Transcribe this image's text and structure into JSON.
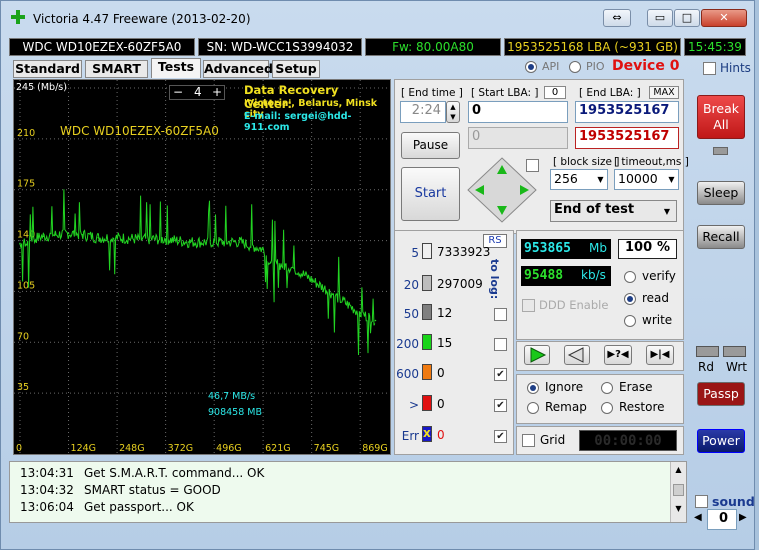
{
  "window": {
    "title": "Victoria 4.47  Freeware (2013-02-20)",
    "time": "15:45:39",
    "controls": {
      "restore": "⇔",
      "minimize": "▭",
      "maximize": "□",
      "close": "✕"
    }
  },
  "infobar": {
    "model": "WDC WD10EZEX-60ZF5A0",
    "serial": "SN: WD-WCC1S3994032",
    "firmware": "Fw: 80.00A80",
    "lba": "1953525168 LBA (~931 GB)"
  },
  "tabs": [
    {
      "label": "Standard"
    },
    {
      "label": "SMART"
    },
    {
      "label": "Tests",
      "active": true
    },
    {
      "label": "Advanced"
    },
    {
      "label": "Setup"
    }
  ],
  "mode": {
    "api": "API",
    "pio": "PIO",
    "device": "Device 0",
    "hints": "Hints"
  },
  "graph": {
    "unit": "245 (Mb/s)",
    "drive_label": "WDC WD10EZEX-60ZF5A0",
    "spinner_value": "4",
    "minus": "−",
    "plus": "+",
    "recovery_title": "Data Recovery Center:",
    "recovery_line1": "'Victoria', Belarus, Minsk city",
    "recovery_line2": "E-mail: sergei@hdd-911.com",
    "y_ticks": [
      "210",
      "175",
      "140",
      "105",
      "70",
      "35"
    ],
    "x_ticks": [
      "0",
      "124G",
      "248G",
      "372G",
      "496G",
      "621G",
      "745G",
      "869G"
    ],
    "speed_readout": "46,7 MB/s",
    "position_readout": "908458 MB"
  },
  "chart_data": {
    "type": "line",
    "title": "",
    "ylabel": "245 (Mb/s)",
    "xlabel": "",
    "ylim": [
      0,
      245
    ],
    "categories": [
      "0",
      "124G",
      "248G",
      "372G",
      "496G",
      "621G",
      "745G",
      "869G"
    ],
    "series": [
      {
        "name": "",
        "x": [
          0,
          30,
          60,
          90,
          124,
          160,
          200,
          248,
          300,
          372,
          430,
          496,
          560,
          621,
          640,
          700,
          745,
          800,
          869,
          908
        ],
        "values": [
          138,
          141,
          143,
          144,
          145,
          144,
          142,
          142,
          141,
          141,
          139,
          139,
          139,
          134,
          125,
          121,
          113,
          103,
          90,
          85
        ]
      }
    ]
  },
  "controls": {
    "end_time_label": "[ End time ]",
    "end_time_value": "2:24",
    "start_lba_label": "[ Start LBA: ]",
    "start_lba_counter": "0",
    "start_lba_value": "0",
    "start_lba_second": "0",
    "end_lba_label": "[ End LBA: ]",
    "max_label": "MAX",
    "end_lba_value": "1953525167",
    "end_lba_current": "1953525167",
    "pause": "Pause",
    "start": "Start",
    "block_size_label": "[ block size ]",
    "block_size_value": "256",
    "timeout_label": "[ timeout,ms ]",
    "timeout_value": "10000",
    "end_action": "End of test",
    "break_line1": "Break",
    "break_line2": "All"
  },
  "counters": {
    "rs": "RS",
    "to_log": "to log:",
    "rows": [
      {
        "level": "5",
        "count": "7333923",
        "color": "#f0f0f0",
        "checked": false
      },
      {
        "level": "20",
        "count": "297009",
        "color": "#bdbdbd",
        "checked": false
      },
      {
        "level": "50",
        "count": "12",
        "color": "#7f7f7f",
        "checked": false
      },
      {
        "level": "200",
        "count": "15",
        "color": "#19d419",
        "checked": false
      },
      {
        "level": "600",
        "count": "0",
        "color": "#f07a10",
        "checked": true
      },
      {
        "level": ">",
        "count": "0",
        "color": "#e01010",
        "checked": true
      },
      {
        "level": "Err",
        "count": "0",
        "color": "#1818c8",
        "checked": true
      }
    ],
    "err_mark": "x"
  },
  "stats": {
    "mb_value": "953865",
    "mb_unit": "Mb",
    "percent": "100",
    "percent_unit": "%",
    "speed_value": "95488",
    "speed_unit": "kb/s",
    "ddd": "DDD Enable",
    "progress": 1.0
  },
  "modes": {
    "verify": "verify",
    "read": "read",
    "write": "write",
    "selected": "read"
  },
  "actions": {
    "ignore": "Ignore",
    "erase": "Erase",
    "remap": "Remap",
    "restore": "Restore",
    "selected": "ignore"
  },
  "grid": {
    "label": "Grid",
    "timer": "00:00:00"
  },
  "side": {
    "sleep": "Sleep",
    "recall": "Recall",
    "rd": "Rd",
    "wrt": "Wrt",
    "passp": "Passp",
    "power": "Power",
    "sound": "sound",
    "sound_value": "0"
  },
  "log": [
    {
      "time": "13:04:31",
      "msg": "Get S.M.A.R.T. command... OK"
    },
    {
      "time": "13:04:32",
      "msg": "SMART status = GOOD"
    },
    {
      "time": "13:06:04",
      "msg": "Get passport... OK"
    }
  ]
}
